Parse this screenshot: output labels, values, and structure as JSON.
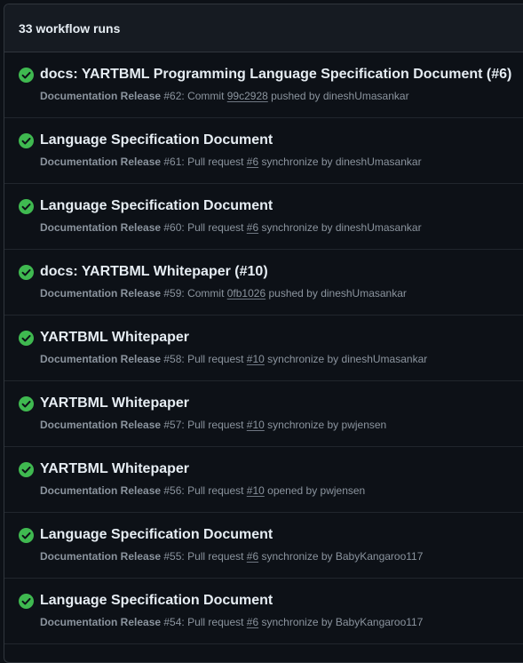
{
  "header": {
    "count_label": "33 workflow runs"
  },
  "runs": [
    {
      "title": "docs: YARTBML Programming Language Specification Document (#6)",
      "workflow": "Documentation Release",
      "run_number": " #62: ",
      "event_prefix": "Commit ",
      "ref": "99c2928",
      "event_suffix": " pushed by ",
      "actor": "dineshUmasankar",
      "status": "success"
    },
    {
      "title": "Language Specification Document",
      "workflow": "Documentation Release",
      "run_number": " #61: ",
      "event_prefix": "Pull request ",
      "ref": "#6",
      "event_suffix": " synchronize by ",
      "actor": "dineshUmasankar",
      "status": "success"
    },
    {
      "title": "Language Specification Document",
      "workflow": "Documentation Release",
      "run_number": " #60: ",
      "event_prefix": "Pull request ",
      "ref": "#6",
      "event_suffix": " synchronize by ",
      "actor": "dineshUmasankar",
      "status": "success"
    },
    {
      "title": "docs: YARTBML Whitepaper (#10)",
      "workflow": "Documentation Release",
      "run_number": " #59: ",
      "event_prefix": "Commit ",
      "ref": "0fb1026",
      "event_suffix": " pushed by ",
      "actor": "dineshUmasankar",
      "status": "success"
    },
    {
      "title": "YARTBML Whitepaper",
      "workflow": "Documentation Release",
      "run_number": " #58: ",
      "event_prefix": "Pull request ",
      "ref": "#10",
      "event_suffix": " synchronize by ",
      "actor": "dineshUmasankar",
      "status": "success"
    },
    {
      "title": "YARTBML Whitepaper",
      "workflow": "Documentation Release",
      "run_number": " #57: ",
      "event_prefix": "Pull request ",
      "ref": "#10",
      "event_suffix": " synchronize by ",
      "actor": "pwjensen",
      "status": "success"
    },
    {
      "title": "YARTBML Whitepaper",
      "workflow": "Documentation Release",
      "run_number": " #56: ",
      "event_prefix": "Pull request ",
      "ref": "#10",
      "event_suffix": " opened by ",
      "actor": "pwjensen",
      "status": "success"
    },
    {
      "title": "Language Specification Document",
      "workflow": "Documentation Release",
      "run_number": " #55: ",
      "event_prefix": "Pull request ",
      "ref": "#6",
      "event_suffix": " synchronize by ",
      "actor": "BabyKangaroo117",
      "status": "success"
    },
    {
      "title": "Language Specification Document",
      "workflow": "Documentation Release",
      "run_number": " #54: ",
      "event_prefix": "Pull request ",
      "ref": "#6",
      "event_suffix": " synchronize by ",
      "actor": "BabyKangaroo117",
      "status": "success"
    }
  ],
  "colors": {
    "success": "#3fb950",
    "background": "#0d1117",
    "header_bg": "#161b22",
    "border": "#30363d",
    "text_primary": "#e6edf3",
    "text_muted": "#8b949e"
  },
  "icons": {
    "status": "check-circle-fill-icon"
  }
}
